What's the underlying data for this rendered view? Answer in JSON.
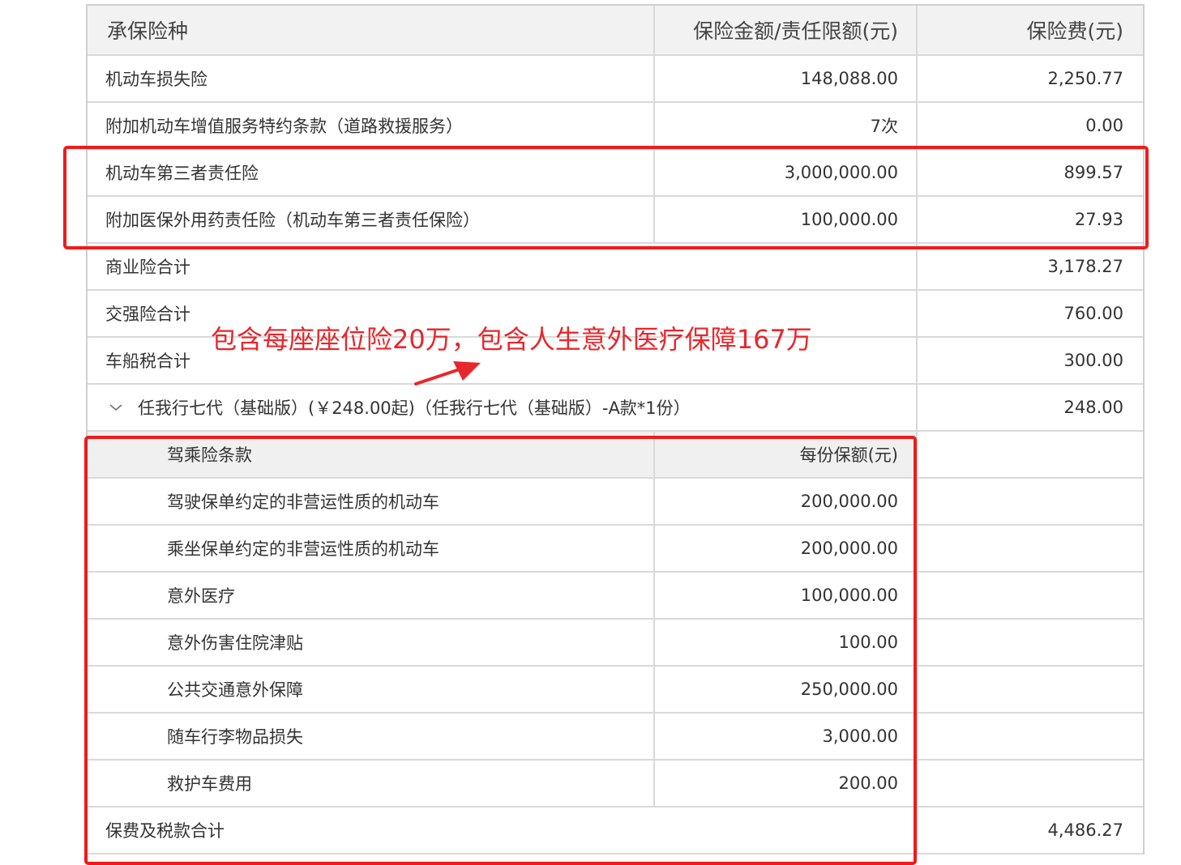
{
  "table": {
    "header": {
      "col1": "承保险种",
      "col2": "保险金额/责任限额(元)",
      "col3": "保险费(元)"
    },
    "rows": [
      {
        "name": "机动车损失险",
        "amount": "148,088.00",
        "premium": "2,250.77"
      },
      {
        "name": "附加机动车增值服务特约条款（道路救援服务）",
        "amount": "7次",
        "premium": "0.00"
      },
      {
        "name": "机动车第三者责任险",
        "amount": "3,000,000.00",
        "premium": "899.57"
      },
      {
        "name": "附加医保外用药责任险（机动车第三者责任保险）",
        "amount": "100,000.00",
        "premium": "27.93"
      }
    ],
    "totals": {
      "commercial_label": "商业险合计",
      "commercial_value": "3,178.27",
      "compulsory_label": "交强险合计",
      "compulsory_value": "760.00",
      "vessel_tax_label": "车船税合计",
      "vessel_tax_value": "300.00"
    },
    "addon": {
      "label": "任我行七代（基础版）(￥248.00起)（任我行七代（基础版）-A款*1份）",
      "premium": "248.00"
    },
    "sub_header": {
      "col1": "驾乘险条款",
      "col2": "每份保额(元)"
    },
    "sub_rows": [
      {
        "name": "驾驶保单约定的非营运性质的机动车",
        "amount": "200,000.00"
      },
      {
        "name": "乘坐保单约定的非营运性质的机动车",
        "amount": "200,000.00"
      },
      {
        "name": "意外医疗",
        "amount": "100,000.00"
      },
      {
        "name": "意外伤害住院津贴",
        "amount": "100.00"
      },
      {
        "name": "公共交通意外保障",
        "amount": "250,000.00"
      },
      {
        "name": "随车行李物品损失",
        "amount": "3,000.00"
      },
      {
        "name": "救护车费用",
        "amount": "200.00"
      }
    ],
    "grand_total": {
      "label": "保费及税款合计",
      "value": "4,486.27"
    }
  },
  "annotation": "包含每座座位险20万，包含人生意外医疗保障167万",
  "colors": {
    "highlight": "#ef1b1b",
    "header_bg": "#f2f2f2",
    "border": "#d9d9d9"
  },
  "icons": {
    "expand": "chevron-down-icon",
    "pointer": "arrow-icon"
  }
}
